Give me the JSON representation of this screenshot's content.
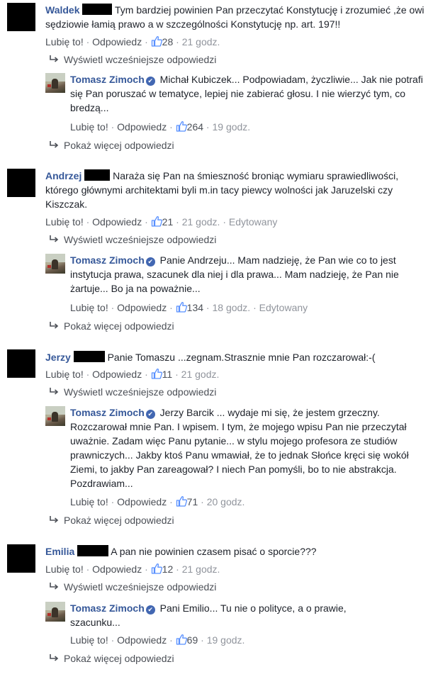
{
  "labels": {
    "like": "Lubię to!",
    "reply": "Odpowiedz",
    "show_earlier": "Wyświetl wcześniejsze odpowiedzi",
    "show_more": "Pokaż więcej odpowiedzi",
    "edited": "Edytowany",
    "separator": "·"
  },
  "threads": [
    {
      "author": "Waldek",
      "text": "Tym bardziej powinien Pan przeczytać Konstytucję i zrozumieć ,że owi sędziowie łamią prawo a w szczególności Konstytucję np. art. 197!!",
      "likes": "28",
      "time": "21 godz.",
      "reply": {
        "author": "Tomasz Zimoch",
        "text": "Michał Kubiczek... Podpowiadam, życzliwie... Jak nie potrafi się Pan poruszać w tematyce, lepiej nie zabierać głosu. I nie wierzyć tym, co bredzą...",
        "likes": "264",
        "time": "19 godz."
      }
    },
    {
      "author": "Andrzej",
      "text": "Naraża się Pan na śmieszność broniąc wymiaru sprawiedliwości, którego głównymi architektami byli m.in tacy piewcy wolności jak Jaruzelski czy Kiszczak.",
      "likes": "21",
      "time": "21 godz.",
      "reply": {
        "author": "Tomasz Zimoch",
        "text": "Panie Andrzeju... Mam nadzieję, że Pan wie co to jest instytucja prawa, szacunek dla niej i dla prawa... Mam nadzieję, że Pan nie żartuje... Bo ja na poważnie...",
        "likes": "134",
        "time": "18 godz."
      }
    },
    {
      "author": "Jerzy",
      "text": "Panie Tomaszu ...zegnam.Strasznie mnie Pan rozczarował:-(",
      "likes": "11",
      "time": "21 godz.",
      "reply": {
        "author": "Tomasz Zimoch",
        "text": "Jerzy Barcik ... wydaje mi się, że jestem grzeczny. Rozczarował mnie Pan. I wpisem. I tym, że mojego wpisu Pan nie przeczytał uważnie. Zadam więc Panu pytanie... w stylu mojego profesora ze studiów prawniczych... Jakby ktoś Panu wmawiał, że to jednak Słońce kręci się wokół Ziemi, to jakby Pan zareagował? I niech Pan pomyśli, bo to nie abstrakcja. Pozdrawiam...",
        "likes": "71",
        "time": "20 godz."
      }
    },
    {
      "author": "Emilia",
      "text": "A pan nie powinien czasem pisać o sporcie???",
      "likes": "12",
      "time": "21 godz.",
      "reply": {
        "author": "Tomasz Zimoch",
        "text": "Pani Emilio... Tu nie o polityce, a o prawie, szacunku...",
        "likes": "69",
        "time": "19 godz."
      }
    }
  ],
  "icons": {
    "like": "thumbs-up-icon",
    "verified": "verified-badge-icon",
    "reply_arrow": "reply-arrow-icon"
  },
  "colors": {
    "name": "#365899",
    "link": "#4b4f56",
    "meta": "#90949c",
    "verified": "#4267b2"
  }
}
